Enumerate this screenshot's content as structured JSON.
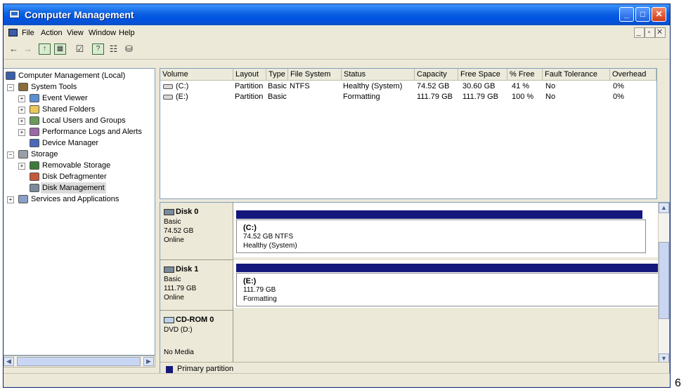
{
  "window": {
    "title": "Computer Management"
  },
  "menubar": {
    "items": [
      "File",
      "Action",
      "View",
      "Window",
      "Help"
    ]
  },
  "tree": {
    "root": "Computer Management (Local)",
    "system_tools": "System Tools",
    "event_viewer": "Event Viewer",
    "shared_folders": "Shared Folders",
    "local_users": "Local Users and Groups",
    "perf_logs": "Performance Logs and Alerts",
    "device_manager": "Device Manager",
    "storage": "Storage",
    "removable_storage": "Removable Storage",
    "disk_defrag": "Disk Defragmenter",
    "disk_mgmt": "Disk Management",
    "services_apps": "Services and Applications"
  },
  "volumes": {
    "columns": [
      "Volume",
      "Layout",
      "Type",
      "File System",
      "Status",
      "Capacity",
      "Free Space",
      "% Free",
      "Fault Tolerance",
      "Overhead"
    ],
    "rows": [
      {
        "volume": "(C:)",
        "layout": "Partition",
        "type": "Basic",
        "fs": "NTFS",
        "status": "Healthy (System)",
        "capacity": "74.52 GB",
        "free": "30.60 GB",
        "pct": "41 %",
        "fault": "No",
        "overhead": "0%"
      },
      {
        "volume": "(E:)",
        "layout": "Partition",
        "type": "Basic",
        "fs": "",
        "status": "Formatting",
        "capacity": "111.79 GB",
        "free": "111.79 GB",
        "pct": "100 %",
        "fault": "No",
        "overhead": "0%"
      }
    ]
  },
  "disks": [
    {
      "name": "Disk 0",
      "type": "Basic",
      "size": "74.52 GB",
      "state": "Online",
      "part_label": "(C:)",
      "part_size": "74.52 GB NTFS",
      "part_status": "Healthy (System)"
    },
    {
      "name": "Disk 1",
      "type": "Basic",
      "size": "111.79 GB",
      "state": "Online",
      "part_label": "(E:)",
      "part_size": "111.79 GB",
      "part_status": "Formatting"
    },
    {
      "name": "CD-ROM 0",
      "type": "DVD (D:)",
      "size": "",
      "state": "No Media"
    }
  ],
  "legend": {
    "primary": "Primary partition"
  },
  "page_number": "6",
  "colors": {
    "titlebar": "#0054e3",
    "partition_bar": "#14177c",
    "chrome": "#ece9d8"
  }
}
